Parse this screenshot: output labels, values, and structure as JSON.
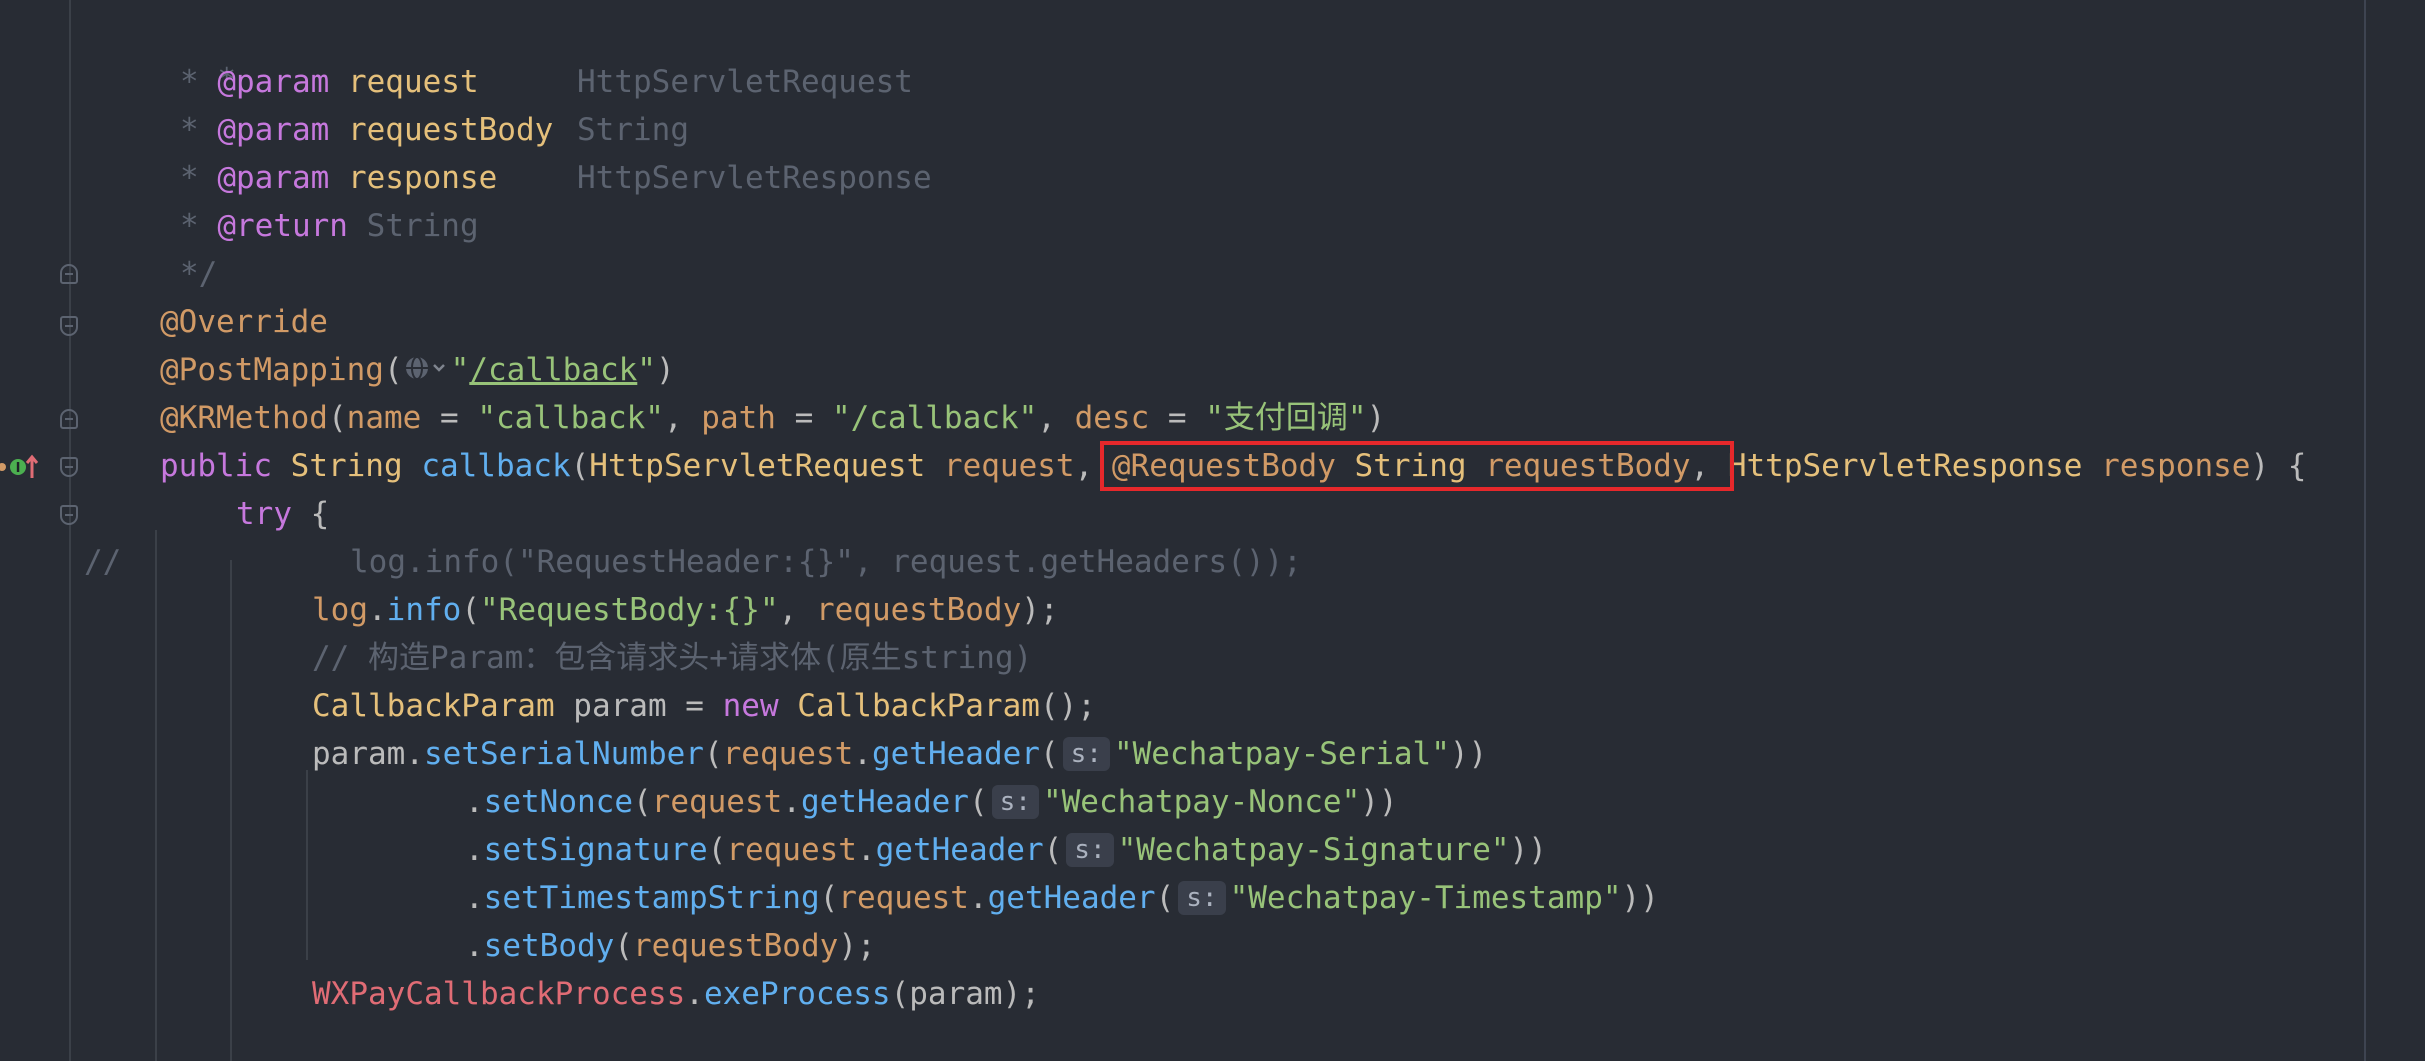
{
  "editor": {
    "lines": {
      "l1": {
        "star": "*"
      },
      "l2": {
        "star": "* ",
        "tag": "@param",
        "name": "request     ",
        "desc": "HttpServletRequest"
      },
      "l3": {
        "star": "* ",
        "tag": "@param",
        "name": "requestBody",
        "desc": "String"
      },
      "l4": {
        "star": "* ",
        "tag": "@param",
        "name": "response    ",
        "desc": "HttpServletResponse"
      },
      "l5": {
        "star": "* ",
        "tag": "@return",
        "desc": "String"
      },
      "l6": {
        "end": "*/"
      },
      "l7": {
        "ann": "@Override"
      },
      "l8": {
        "ann": "@PostMapping",
        "open": "(",
        "q1": "\"",
        "path": "/callback",
        "q2": "\"",
        "close": ")"
      },
      "l9": {
        "ann": "@KRMethod",
        "open": "(",
        "k1": "name",
        "eq1": " = ",
        "v1": "\"callback\"",
        "sep1": ", ",
        "k2": "path",
        "eq2": " = ",
        "v2": "\"/callback\"",
        "sep2": ", ",
        "k3": "desc",
        "eq3": " = ",
        "v3": "\"支付回调\"",
        "close": ")"
      },
      "l10": {
        "kw": "public",
        "type": "String",
        "fn": "callback",
        "open": "(",
        "t1": "HttpServletRequest",
        "p1": "request",
        "sep1": ", ",
        "ann": "@RequestBody",
        "t2": "String",
        "p2": "requestBody",
        "sep2": ", ",
        "t3": "HttpServletResponse",
        "p3": "response",
        "close": ") {"
      },
      "l11": {
        "kw": "try",
        "brace": " {"
      },
      "l12": {
        "slashes": "//",
        "text": "log.info(\"RequestHeader:{}\", request.getHeaders());"
      },
      "l13": {
        "obj": "log",
        "dot": ".",
        "fn": "info",
        "open": "(",
        "str": "\"RequestBody:{}\"",
        "sep": ", ",
        "arg": "requestBody",
        "close": ");"
      },
      "l14": {
        "comment": "// 构造Param：包含请求头+请求体(原生string)"
      },
      "l15": {
        "type": "CallbackParam",
        "var": " param = ",
        "kw": "new",
        "ctor": "CallbackParam",
        "close": "();"
      },
      "l16": {
        "obj": "param",
        "dot": ".",
        "fn": "setSerialNumber",
        "open": "(",
        "req": "request",
        "dot2": ".",
        "fn2": "getHeader",
        "open2": "(",
        "hint": "s:",
        "str": "\"Wechatpay-Serial\"",
        "close": "))"
      },
      "l17": {
        "dot": ".",
        "fn": "setNonce",
        "open": "(",
        "req": "request",
        "dot2": ".",
        "fn2": "getHeader",
        "open2": "(",
        "hint": "s:",
        "str": "\"Wechatpay-Nonce\"",
        "close": "))"
      },
      "l18": {
        "dot": ".",
        "fn": "setSignature",
        "open": "(",
        "req": "request",
        "dot2": ".",
        "fn2": "getHeader",
        "open2": "(",
        "hint": "s:",
        "str": "\"Wechatpay-Signature\"",
        "close": "))"
      },
      "l19": {
        "dot": ".",
        "fn": "setTimestampString",
        "open": "(",
        "req": "request",
        "dot2": ".",
        "fn2": "getHeader",
        "open2": "(",
        "hint": "s:",
        "str": "\"Wechatpay-Timestamp\"",
        "close": "))"
      },
      "l20": {
        "dot": ".",
        "fn": "setBody",
        "open": "(",
        "arg": "requestBody",
        "close": ");"
      },
      "l21": {
        "cls": "WXPayCallbackProcess",
        "dot": ".",
        "fn": "exeProcess",
        "open": "(",
        "arg": "param",
        "close": ");"
      }
    },
    "colors": {
      "background": "#282c34",
      "highlight_box": "#e6282b",
      "keyword": "#c678dd",
      "string": "#98c379",
      "function": "#61afef",
      "type": "#e5c07b"
    },
    "icons": [
      "globe-icon",
      "chevron-down-icon",
      "implements-icon",
      "fold-marker-icon"
    ]
  }
}
